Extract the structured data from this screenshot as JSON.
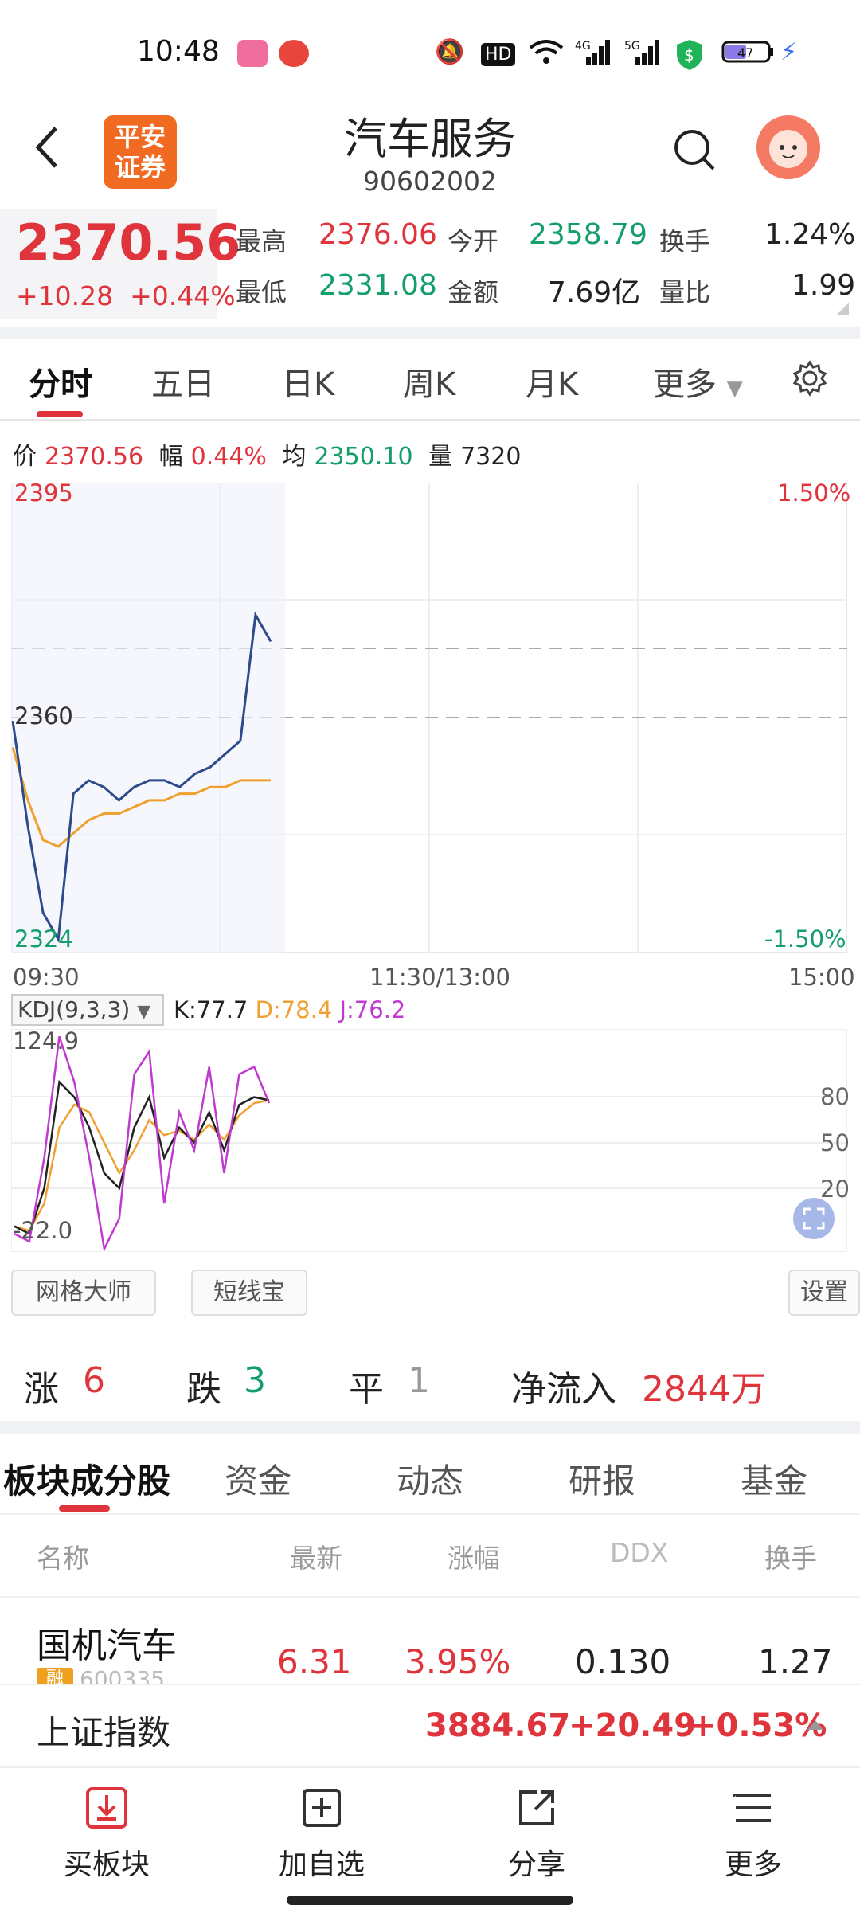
{
  "status_bar": {
    "time": "10:48",
    "battery": "47"
  },
  "header": {
    "title": "汽车服务",
    "code": "90602002",
    "logo_text": "平安证券"
  },
  "quote": {
    "price": "2370.56",
    "change": "+10.28",
    "change_pct": "+0.44%",
    "high_label": "最高",
    "high": "2376.06",
    "low_label": "最低",
    "low": "2331.08",
    "open_label": "今开",
    "open": "2358.79",
    "amount_label": "金额",
    "amount": "7.69亿",
    "turnover_label": "换手",
    "turnover": "1.24%",
    "vol_ratio_label": "量比",
    "vol_ratio": "1.99"
  },
  "chart_tabs": [
    "分时",
    "五日",
    "日K",
    "周K",
    "月K",
    "更多"
  ],
  "info_row": {
    "price_label": "价",
    "price": "2370.56",
    "pct_label": "幅",
    "pct": "0.44%",
    "avg_label": "均",
    "avg": "2350.10",
    "vol_label": "量",
    "vol": "7320"
  },
  "chart_labels": {
    "y_top": "2395",
    "y_mid": "2360",
    "y_bottom": "2324",
    "pct_top": "1.50%",
    "pct_bottom": "-1.50%",
    "x_start": "09:30",
    "x_mid": "11:30/13:00",
    "x_end": "15:00"
  },
  "kdj": {
    "selector": "KDJ(9,3,3)",
    "k": "K:77.7",
    "d": "D:78.4",
    "j": "J:76.2",
    "max": "124.9",
    "min": "-22.0",
    "levels": [
      "80",
      "50",
      "20"
    ]
  },
  "tools": {
    "grid": "网格大师",
    "short": "短线宝",
    "settings": "设置"
  },
  "stats": {
    "up_label": "涨",
    "up": "6",
    "down_label": "跌",
    "down": "3",
    "flat_label": "平",
    "flat": "1",
    "inflow_label": "净流入",
    "inflow": "2844万"
  },
  "sub_tabs": [
    "板块成分股",
    "资金",
    "动态",
    "研报",
    "基金"
  ],
  "table": {
    "headers": [
      "名称",
      "最新",
      "涨幅",
      "DDX",
      "换手"
    ],
    "rows": [
      {
        "name": "国机汽车",
        "tag": "融",
        "code": "600335",
        "last": "6.31",
        "pct": "3.95%",
        "ddx": "0.130",
        "turnover": "1.27"
      }
    ]
  },
  "index_bar": {
    "name": "上证指数",
    "value": "3884.67",
    "change": "+20.49",
    "pct": "+0.53%"
  },
  "bottom_nav": [
    "买板块",
    "加自选",
    "分享",
    "更多"
  ],
  "chart_data": [
    {
      "type": "line",
      "series": [
        {
          "name": "价",
          "x": [
            "09:30",
            "09:33",
            "09:36",
            "09:40",
            "09:45",
            "09:50",
            "09:55",
            "10:00",
            "10:05",
            "10:10",
            "10:15",
            "10:20",
            "10:25",
            "10:30",
            "10:35",
            "10:40",
            "10:45",
            "10:48"
          ],
          "values": [
            2359,
            2343,
            2330,
            2326,
            2348,
            2350,
            2349,
            2347,
            2349,
            2350,
            2350,
            2349,
            2351,
            2352,
            2354,
            2356,
            2375,
            2371
          ]
        },
        {
          "name": "均",
          "x": [
            "09:30",
            "09:33",
            "09:36",
            "09:40",
            "09:45",
            "09:50",
            "09:55",
            "10:00",
            "10:05",
            "10:10",
            "10:15",
            "10:20",
            "10:25",
            "10:30",
            "10:35",
            "10:40",
            "10:45",
            "10:48"
          ],
          "values": [
            2355,
            2347,
            2341,
            2340,
            2342,
            2344,
            2345,
            2345,
            2346,
            2347,
            2347,
            2348,
            2348,
            2349,
            2349,
            2350,
            2350,
            2350
          ]
        }
      ],
      "ylim": [
        2324,
        2395
      ]
    },
    {
      "type": "line",
      "series": [
        {
          "name": "K",
          "values": [
            -5,
            -10,
            20,
            90,
            80,
            60,
            30,
            20,
            60,
            80,
            40,
            60,
            50,
            70,
            45,
            75,
            80,
            78
          ]
        },
        {
          "name": "D",
          "values": [
            -5,
            -8,
            10,
            60,
            75,
            70,
            50,
            30,
            45,
            65,
            55,
            58,
            52,
            62,
            52,
            68,
            76,
            78
          ]
        },
        {
          "name": "J",
          "values": [
            -10,
            -15,
            40,
            120,
            90,
            40,
            -20,
            0,
            95,
            110,
            10,
            70,
            45,
            100,
            30,
            95,
            100,
            76
          ]
        }
      ],
      "ylim": [
        -22.0,
        124.9
      ]
    }
  ]
}
